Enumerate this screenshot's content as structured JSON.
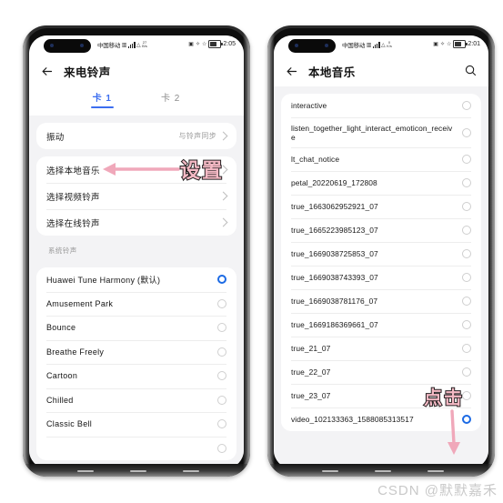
{
  "watermark": "CSDN @默默嘉禾",
  "annotations": [
    {
      "name": "settings-annotation",
      "text": "设置"
    },
    {
      "name": "tap-annotation",
      "text": "点击"
    }
  ],
  "left_phone": {
    "status_bar": {
      "carrier": "中国移动",
      "net_speed_top": "27",
      "net_speed_bottom": "B/s",
      "clock": "2:05",
      "battery_icon": "battery-icon",
      "signal_icon": "signal-bars-icon",
      "wifi_icon": "wifi-icon"
    },
    "header": {
      "back_icon": "back-arrow-icon",
      "title": "来电铃声"
    },
    "tabs": [
      {
        "label": "卡 1",
        "active": true
      },
      {
        "label": "卡 2",
        "active": false
      }
    ],
    "vibration_card": [
      {
        "label": "振动",
        "value": "与铃声同步",
        "chevron": "chevron-right-icon"
      }
    ],
    "source_card": [
      {
        "label": "选择本地音乐",
        "chevron": "chevron-right-icon"
      },
      {
        "label": "选择视频铃声",
        "chevron": "chevron-right-icon"
      },
      {
        "label": "选择在线铃声",
        "chevron": "chevron-right-icon"
      }
    ],
    "section_header": "系统铃声",
    "ringtones": [
      {
        "label": "Huawei Tune Harmony (默认)",
        "selected": true
      },
      {
        "label": "Amusement Park",
        "selected": false
      },
      {
        "label": "Bounce",
        "selected": false
      },
      {
        "label": "Breathe Freely",
        "selected": false
      },
      {
        "label": "Cartoon",
        "selected": false
      },
      {
        "label": "Chilled",
        "selected": false
      },
      {
        "label": "Classic Bell",
        "selected": false
      },
      {
        "label": "",
        "selected": false
      }
    ]
  },
  "right_phone": {
    "status_bar": {
      "carrier": "中国移动",
      "net_speed_top": "0",
      "net_speed_bottom": "K/s",
      "clock": "2:01",
      "battery_icon": "battery-icon",
      "signal_icon": "signal-bars-icon",
      "wifi_icon": "wifi-icon"
    },
    "header": {
      "back_icon": "back-arrow-icon",
      "title": "本地音乐",
      "search_icon": "search-icon"
    },
    "tracks": [
      {
        "label": "interactive",
        "selected": false,
        "tall": false
      },
      {
        "label": "listen_together_light_interact_emoticon_receive",
        "selected": false,
        "tall": true
      },
      {
        "label": "lt_chat_notice",
        "selected": false,
        "tall": false
      },
      {
        "label": "petal_20220619_172808",
        "selected": false,
        "tall": false
      },
      {
        "label": "true_1663062952921_07",
        "selected": false,
        "tall": false
      },
      {
        "label": "true_1665223985123_07",
        "selected": false,
        "tall": false
      },
      {
        "label": "true_1669038725853_07",
        "selected": false,
        "tall": false
      },
      {
        "label": "true_1669038743393_07",
        "selected": false,
        "tall": false
      },
      {
        "label": "true_1669038781176_07",
        "selected": false,
        "tall": false
      },
      {
        "label": "true_1669186369661_07",
        "selected": false,
        "tall": false
      },
      {
        "label": "true_21_07",
        "selected": false,
        "tall": false
      },
      {
        "label": "true_22_07",
        "selected": false,
        "tall": false
      },
      {
        "label": "true_23_07",
        "selected": false,
        "tall": false
      },
      {
        "label": "video_102133363_1588085313517",
        "selected": true,
        "tall": false
      }
    ]
  }
}
